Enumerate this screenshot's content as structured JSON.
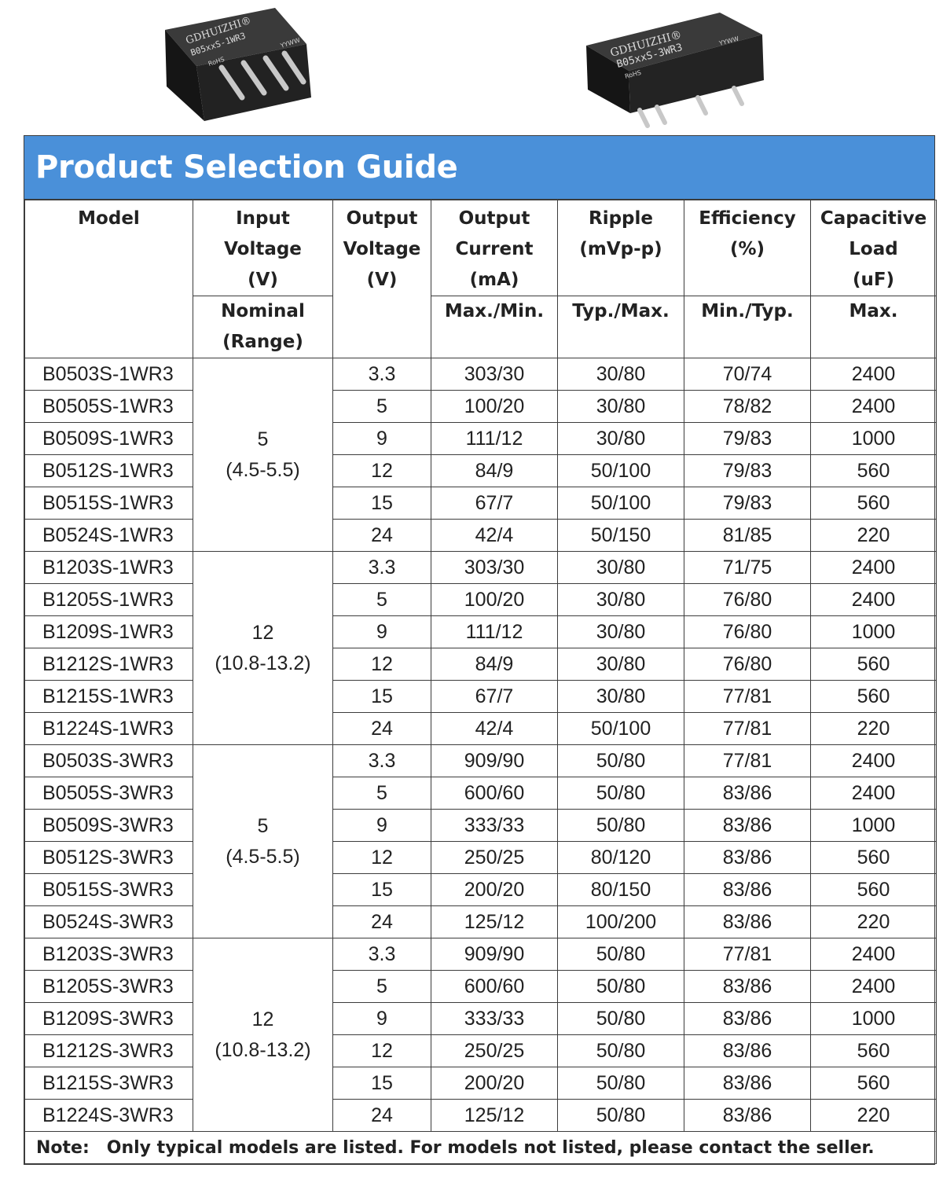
{
  "title": "Product Selection Guide",
  "images": [
    {
      "brand": "GDHUIZHI®",
      "part": "B05xxS-1WR3",
      "mark": "RoHS",
      "date_code": "YYWW"
    },
    {
      "brand": "GDHUIZHI®",
      "part": "B05xxS-3WR3",
      "mark": "RoHS",
      "date_code": "YYWW"
    }
  ],
  "headers": {
    "model": "Model",
    "input": [
      "Input",
      "Voltage",
      "(V)"
    ],
    "output_voltage": [
      "Output",
      "Voltage",
      "(V)"
    ],
    "output_current": [
      "Output",
      "Current",
      "(mA)"
    ],
    "ripple": [
      "Ripple",
      "(mVp-p)"
    ],
    "efficiency": [
      "Efficiency",
      "(%)"
    ],
    "capacitive": [
      "Capacitive",
      "Load",
      "(uF)"
    ]
  },
  "subheaders": {
    "input": [
      "Nominal",
      "(Range)"
    ],
    "output_current": "Max./Min.",
    "ripple": "Typ./Max.",
    "efficiency": "Min./Typ.",
    "capacitive": "Max."
  },
  "groups": [
    {
      "nominal": "5",
      "range": "(4.5-5.5)",
      "rows": [
        {
          "model": "B0503S-1WR3",
          "vout": "3.3",
          "current": "303/30",
          "ripple": "30/80",
          "eff": "70/74",
          "cap": "2400"
        },
        {
          "model": "B0505S-1WR3",
          "vout": "5",
          "current": "100/20",
          "ripple": "30/80",
          "eff": "78/82",
          "cap": "2400"
        },
        {
          "model": "B0509S-1WR3",
          "vout": "9",
          "current": "111/12",
          "ripple": "30/80",
          "eff": "79/83",
          "cap": "1000"
        },
        {
          "model": "B0512S-1WR3",
          "vout": "12",
          "current": "84/9",
          "ripple": "50/100",
          "eff": "79/83",
          "cap": "560"
        },
        {
          "model": "B0515S-1WR3",
          "vout": "15",
          "current": "67/7",
          "ripple": "50/100",
          "eff": "79/83",
          "cap": "560"
        },
        {
          "model": "B0524S-1WR3",
          "vout": "24",
          "current": "42/4",
          "ripple": "50/150",
          "eff": "81/85",
          "cap": "220"
        }
      ]
    },
    {
      "nominal": "12",
      "range": "(10.8-13.2)",
      "rows": [
        {
          "model": "B1203S-1WR3",
          "vout": "3.3",
          "current": "303/30",
          "ripple": "30/80",
          "eff": "71/75",
          "cap": "2400"
        },
        {
          "model": "B1205S-1WR3",
          "vout": "5",
          "current": "100/20",
          "ripple": "30/80",
          "eff": "76/80",
          "cap": "2400"
        },
        {
          "model": "B1209S-1WR3",
          "vout": "9",
          "current": "111/12",
          "ripple": "30/80",
          "eff": "76/80",
          "cap": "1000"
        },
        {
          "model": "B1212S-1WR3",
          "vout": "12",
          "current": "84/9",
          "ripple": "30/80",
          "eff": "76/80",
          "cap": "560"
        },
        {
          "model": "B1215S-1WR3",
          "vout": "15",
          "current": "67/7",
          "ripple": "30/80",
          "eff": "77/81",
          "cap": "560"
        },
        {
          "model": "B1224S-1WR3",
          "vout": "24",
          "current": "42/4",
          "ripple": "50/100",
          "eff": "77/81",
          "cap": "220"
        }
      ]
    },
    {
      "nominal": "5",
      "range": "(4.5-5.5)",
      "rows": [
        {
          "model": "B0503S-3WR3",
          "vout": "3.3",
          "current": "909/90",
          "ripple": "50/80",
          "eff": "77/81",
          "cap": "2400"
        },
        {
          "model": "B0505S-3WR3",
          "vout": "5",
          "current": "600/60",
          "ripple": "50/80",
          "eff": "83/86",
          "cap": "2400"
        },
        {
          "model": "B0509S-3WR3",
          "vout": "9",
          "current": "333/33",
          "ripple": "50/80",
          "eff": "83/86",
          "cap": "1000"
        },
        {
          "model": "B0512S-3WR3",
          "vout": "12",
          "current": "250/25",
          "ripple": "80/120",
          "eff": "83/86",
          "cap": "560"
        },
        {
          "model": "B0515S-3WR3",
          "vout": "15",
          "current": "200/20",
          "ripple": "80/150",
          "eff": "83/86",
          "cap": "560"
        },
        {
          "model": "B0524S-3WR3",
          "vout": "24",
          "current": "125/12",
          "ripple": "100/200",
          "eff": "83/86",
          "cap": "220"
        }
      ]
    },
    {
      "nominal": "12",
      "range": "(10.8-13.2)",
      "rows": [
        {
          "model": "B1203S-3WR3",
          "vout": "3.3",
          "current": "909/90",
          "ripple": "50/80",
          "eff": "77/81",
          "cap": "2400"
        },
        {
          "model": "B1205S-3WR3",
          "vout": "5",
          "current": "600/60",
          "ripple": "50/80",
          "eff": "83/86",
          "cap": "2400"
        },
        {
          "model": "B1209S-3WR3",
          "vout": "9",
          "current": "333/33",
          "ripple": "50/80",
          "eff": "83/86",
          "cap": "1000"
        },
        {
          "model": "B1212S-3WR3",
          "vout": "12",
          "current": "250/25",
          "ripple": "50/80",
          "eff": "83/86",
          "cap": "560"
        },
        {
          "model": "B1215S-3WR3",
          "vout": "15",
          "current": "200/20",
          "ripple": "50/80",
          "eff": "83/86",
          "cap": "560"
        },
        {
          "model": "B1224S-3WR3",
          "vout": "24",
          "current": "125/12",
          "ripple": "50/80",
          "eff": "83/86",
          "cap": "220"
        }
      ]
    }
  ],
  "note": {
    "label": "Note:",
    "text": "Only typical models are listed. For models not listed, please contact the seller."
  },
  "colors": {
    "header_bg": "#4a90d9",
    "header_text": "#ffffff",
    "border": "#3c3c3c"
  }
}
